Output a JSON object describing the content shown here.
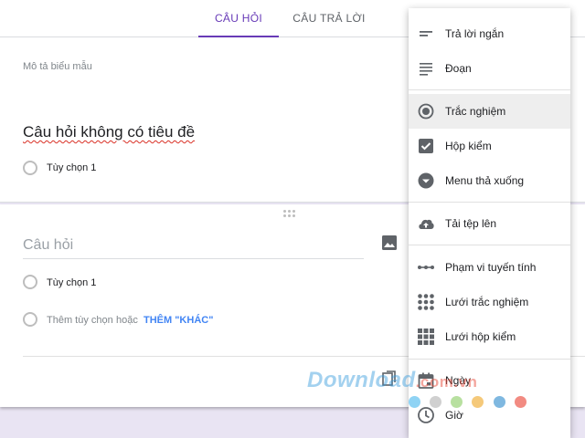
{
  "tabs": [
    {
      "label": "CÂU HỎI",
      "active": true
    },
    {
      "label": "CÂU TRẢ LỜI",
      "active": false
    }
  ],
  "card1": {
    "form_description": "Mô tả biểu mẫu",
    "question_title": "Câu hỏi không có tiêu đề",
    "option_1": "Tùy chọn 1"
  },
  "card2": {
    "question_placeholder": "Câu hỏi",
    "option_1": "Tùy chọn 1",
    "add_option": "Thêm tùy chọn",
    "or_text": "hoặc",
    "add_other": "THÊM \"KHÁC\""
  },
  "menu": {
    "items": [
      {
        "label": "Trả lời ngắn",
        "icon": "short-answer-icon"
      },
      {
        "label": "Đoạn",
        "icon": "paragraph-icon"
      },
      {
        "label": "Trắc nghiệm",
        "icon": "radio-button-icon",
        "selected": true
      },
      {
        "label": "Hộp kiểm",
        "icon": "checkbox-icon"
      },
      {
        "label": "Menu thả xuống",
        "icon": "dropdown-icon"
      },
      {
        "label": "Tải tệp lên",
        "icon": "cloud-upload-icon"
      },
      {
        "label": "Phạm vi tuyến tính",
        "icon": "linear-scale-icon"
      },
      {
        "label": "Lưới trắc nghiệm",
        "icon": "grid-dots-icon"
      },
      {
        "label": "Lưới hộp kiểm",
        "icon": "grid-squares-icon"
      },
      {
        "label": "Ngày",
        "icon": "calendar-icon"
      },
      {
        "label": "Giờ",
        "icon": "clock-icon"
      }
    ]
  },
  "palette": [
    "#8fd3f4",
    "#d0d0d0",
    "#b8e0a0",
    "#f5c97a",
    "#7fb8e0",
    "#f28b82"
  ],
  "watermark": {
    "brand": "Download",
    "suffix": ".com.vn"
  },
  "colors": {
    "accent": "#673ab7",
    "link": "#4285f4",
    "spellcheck": "#d93025"
  }
}
